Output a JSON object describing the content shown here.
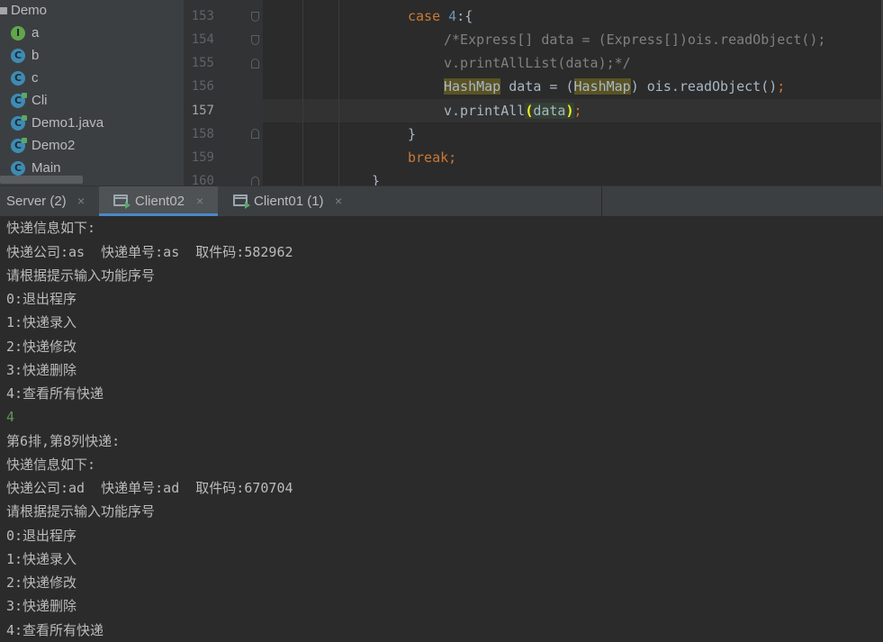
{
  "project_tree": {
    "root": "Demo",
    "items": [
      {
        "name": "a",
        "icon": "interface-icon",
        "kind": "I"
      },
      {
        "name": "b",
        "icon": "class-icon",
        "kind": "C"
      },
      {
        "name": "c",
        "icon": "class-icon",
        "kind": "C"
      },
      {
        "name": "Cli",
        "icon": "runnable-class-icon",
        "kind": "C"
      },
      {
        "name": "Demo1.java",
        "icon": "runnable-class-icon",
        "kind": "C"
      },
      {
        "name": "Demo2",
        "icon": "runnable-class-icon",
        "kind": "C"
      },
      {
        "name": "Main",
        "icon": "class-icon",
        "kind": "C"
      }
    ]
  },
  "editor": {
    "current_line": "157",
    "line_numbers": [
      "153",
      "154",
      "155",
      "156",
      "157",
      "158",
      "159",
      "160"
    ],
    "code": {
      "l153_kw": "case",
      "l153_num": "4",
      "l153_rest": ":{",
      "l154": "/*Express[] data = (Express[])ois.readObject();",
      "l155": "v.printAllList(data);*/",
      "l156_type1": "HashMap",
      "l156_mid": " data = (",
      "l156_type2": "HashMap",
      "l156_rest": ") ois.readObject()",
      "l156_semi": ";",
      "l157_obj": "v",
      "l157_call": ".printAll",
      "l157_lp": "(",
      "l157_arg": "data",
      "l157_rp": ")",
      "l157_semi": ";",
      "l158": "}",
      "l159_kw": "break",
      "l159_semi": ";",
      "l160": "}"
    }
  },
  "run_tabs": [
    {
      "label": "Server (2)",
      "active": false
    },
    {
      "label": "Client02",
      "active": true
    },
    {
      "label": "Client01 (1)",
      "active": false
    }
  ],
  "tab_close_glyph": "×",
  "console": {
    "lines": [
      {
        "text": "快递信息如下:",
        "type": "output"
      },
      {
        "text": "快递公司:as  快递单号:as  取件码:582962",
        "type": "output"
      },
      {
        "text": "请根据提示输入功能序号",
        "type": "output"
      },
      {
        "text": "0:退出程序",
        "type": "output"
      },
      {
        "text": "1:快递录入",
        "type": "output"
      },
      {
        "text": "2:快递修改",
        "type": "output"
      },
      {
        "text": "3:快递删除",
        "type": "output"
      },
      {
        "text": "4:查看所有快递",
        "type": "output"
      },
      {
        "text": "4",
        "type": "input"
      },
      {
        "text": "第6排,第8列快递:",
        "type": "output"
      },
      {
        "text": "快递信息如下:",
        "type": "output"
      },
      {
        "text": "快递公司:ad  快递单号:ad  取件码:670704",
        "type": "output"
      },
      {
        "text": "请根据提示输入功能序号",
        "type": "output"
      },
      {
        "text": "0:退出程序",
        "type": "output"
      },
      {
        "text": "1:快递录入",
        "type": "output"
      },
      {
        "text": "2:快递修改",
        "type": "output"
      },
      {
        "text": "3:快递删除",
        "type": "output"
      },
      {
        "text": "4:查看所有快递",
        "type": "output"
      }
    ]
  },
  "colors": {
    "background": "#2b2b2b",
    "panel": "#3c3f41",
    "keyword": "#cc7832",
    "number": "#6897bb",
    "comment": "#808080",
    "user_input": "#629755",
    "active_tab_underline": "#4a88c7"
  }
}
